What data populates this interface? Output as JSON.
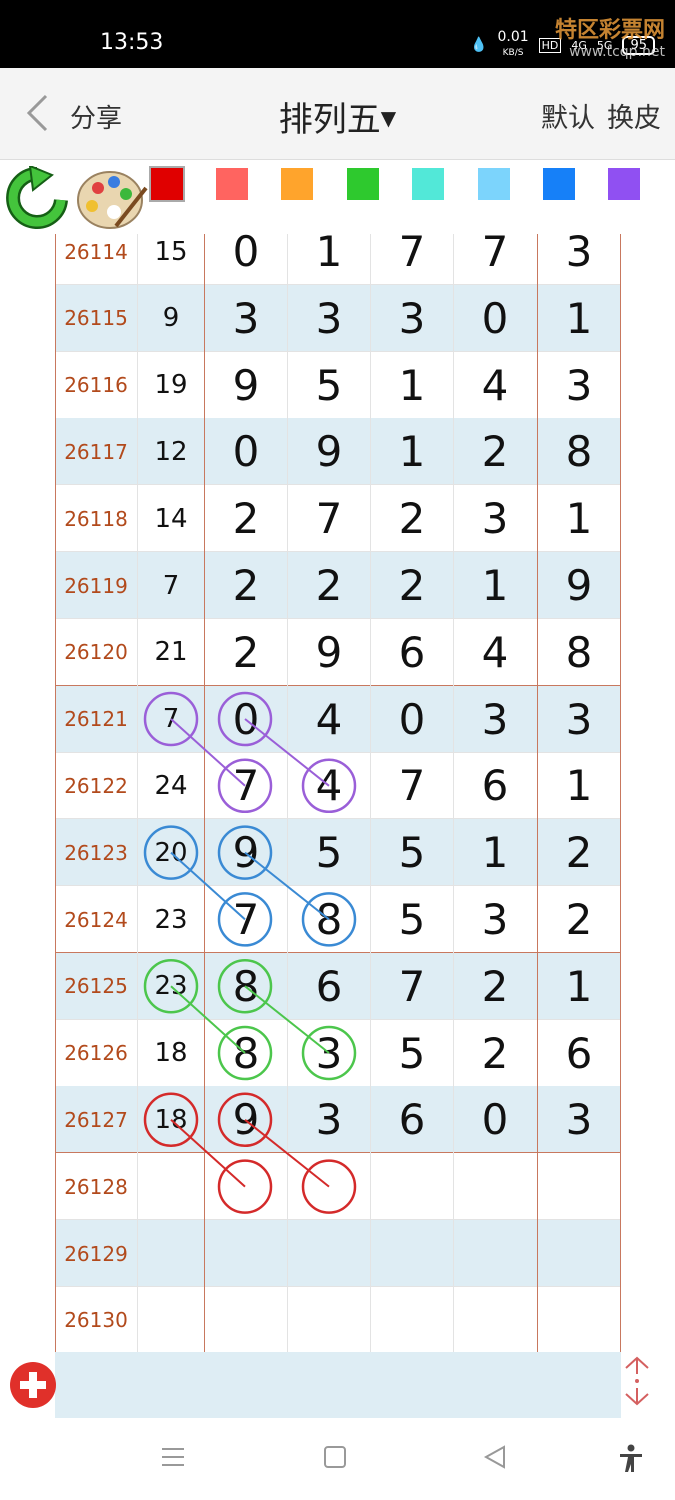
{
  "status": {
    "time": "13:53",
    "net_speed": "0.01",
    "net_unit": "KB/S",
    "hd": "HD",
    "sig4g": "4G",
    "sig5g": "5G",
    "battery": "95"
  },
  "watermark": {
    "name": "特区彩票网",
    "url": "www.tcqp.net"
  },
  "nav": {
    "share": "分享",
    "title": "排列五",
    "default": "默认",
    "skin": "换皮"
  },
  "swatches": [
    "#e00000",
    "#ff6460",
    "#ffa42c",
    "#2ec92e",
    "#52e8d8",
    "#7cd4fc",
    "#1680f8",
    "#9050f2"
  ],
  "rows": [
    {
      "issue": "26114",
      "sum": "15",
      "digits": [
        "0",
        "1",
        "7",
        "7",
        "3"
      ]
    },
    {
      "issue": "26115",
      "sum": "9",
      "digits": [
        "3",
        "3",
        "3",
        "0",
        "1"
      ]
    },
    {
      "issue": "26116",
      "sum": "19",
      "digits": [
        "9",
        "5",
        "1",
        "4",
        "3"
      ]
    },
    {
      "issue": "26117",
      "sum": "12",
      "digits": [
        "0",
        "9",
        "1",
        "2",
        "8"
      ]
    },
    {
      "issue": "26118",
      "sum": "14",
      "digits": [
        "2",
        "7",
        "2",
        "3",
        "1"
      ]
    },
    {
      "issue": "26119",
      "sum": "7",
      "digits": [
        "2",
        "2",
        "2",
        "1",
        "9"
      ]
    },
    {
      "issue": "26120",
      "sum": "21",
      "digits": [
        "2",
        "9",
        "6",
        "4",
        "8"
      ]
    },
    {
      "issue": "26121",
      "sum": "7",
      "digits": [
        "0",
        "4",
        "0",
        "3",
        "3"
      ]
    },
    {
      "issue": "26122",
      "sum": "24",
      "digits": [
        "7",
        "4",
        "7",
        "6",
        "1"
      ]
    },
    {
      "issue": "26123",
      "sum": "20",
      "digits": [
        "9",
        "5",
        "5",
        "1",
        "2"
      ]
    },
    {
      "issue": "26124",
      "sum": "23",
      "digits": [
        "7",
        "8",
        "5",
        "3",
        "2"
      ]
    },
    {
      "issue": "26125",
      "sum": "23",
      "digits": [
        "8",
        "6",
        "7",
        "2",
        "1"
      ]
    },
    {
      "issue": "26126",
      "sum": "18",
      "digits": [
        "8",
        "3",
        "5",
        "2",
        "6"
      ]
    },
    {
      "issue": "26127",
      "sum": "18",
      "digits": [
        "9",
        "3",
        "6",
        "0",
        "3"
      ]
    },
    {
      "issue": "26128",
      "sum": "",
      "digits": [
        "",
        "",
        "",
        "",
        ""
      ]
    },
    {
      "issue": "26129",
      "sum": "",
      "digits": [
        "",
        "",
        "",
        "",
        ""
      ]
    },
    {
      "issue": "26130",
      "sum": "",
      "digits": [
        "",
        "",
        "",
        "",
        ""
      ]
    }
  ],
  "markings": [
    {
      "color": "#9a5fd8",
      "circles": [
        [
          7,
          "sum"
        ],
        [
          7,
          0
        ],
        [
          8,
          0
        ],
        [
          8,
          1
        ]
      ],
      "lines": [
        [
          [
            7,
            "sum"
          ],
          [
            8,
            0
          ]
        ],
        [
          [
            7,
            0
          ],
          [
            8,
            1
          ]
        ]
      ]
    },
    {
      "color": "#3a8ad4",
      "circles": [
        [
          9,
          "sum"
        ],
        [
          9,
          0
        ],
        [
          10,
          0
        ],
        [
          10,
          1
        ]
      ],
      "lines": [
        [
          [
            9,
            "sum"
          ],
          [
            10,
            0
          ]
        ],
        [
          [
            9,
            0
          ],
          [
            10,
            1
          ]
        ]
      ]
    },
    {
      "color": "#4cc64c",
      "circles": [
        [
          11,
          "sum"
        ],
        [
          11,
          0
        ],
        [
          12,
          0
        ],
        [
          12,
          1
        ]
      ],
      "lines": [
        [
          [
            11,
            "sum"
          ],
          [
            12,
            0
          ]
        ],
        [
          [
            11,
            0
          ],
          [
            12,
            1
          ]
        ]
      ]
    },
    {
      "color": "#d42a2a",
      "circles": [
        [
          13,
          "sum"
        ],
        [
          13,
          0
        ],
        [
          14,
          0
        ],
        [
          14,
          1
        ]
      ],
      "lines": [
        [
          [
            13,
            "sum"
          ],
          [
            14,
            0
          ]
        ],
        [
          [
            13,
            0
          ],
          [
            14,
            1
          ]
        ]
      ]
    }
  ]
}
